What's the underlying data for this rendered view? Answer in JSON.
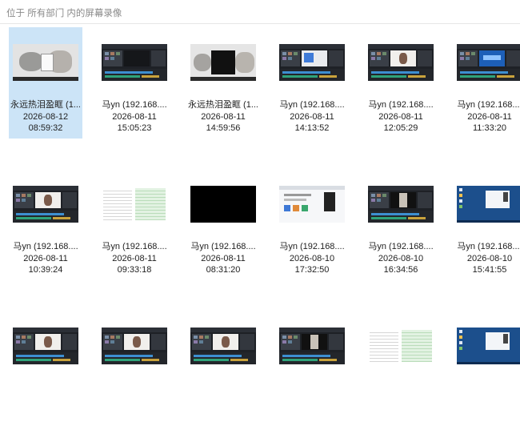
{
  "search": {
    "placeholder": "位于 所有部门 内的屏幕录像"
  },
  "items": [
    {
      "name": "永远热泪盈眶 (1...",
      "date": "2026-08-12",
      "time": "08:59:32",
      "thumb": "cat-image",
      "selected": true
    },
    {
      "name": "马yn (192.168....",
      "date": "2026-08-11",
      "time": "15:05:23",
      "thumb": "video-editor"
    },
    {
      "name": "永远热泪盈眶 (1...",
      "date": "2026-08-11",
      "time": "14:59:56",
      "thumb": "cat-image-dark"
    },
    {
      "name": "马yn (192.168....",
      "date": "2026-08-11",
      "time": "14:13:52",
      "thumb": "video-editor-dialog"
    },
    {
      "name": "马yn (192.168....",
      "date": "2026-08-11",
      "time": "12:05:29",
      "thumb": "video-editor-portrait"
    },
    {
      "name": "马yn (192.168....",
      "date": "2026-08-11",
      "time": "11:33:20",
      "thumb": "video-editor-blue"
    },
    {
      "name": "马yn (192.168....",
      "date": "2026-08-11",
      "time": "10:39:24",
      "thumb": "video-editor-portrait"
    },
    {
      "name": "马yn (192.168....",
      "date": "2026-08-11",
      "time": "09:33:18",
      "thumb": "spreadsheet"
    },
    {
      "name": "马yn (192.168....",
      "date": "2026-08-11",
      "time": "08:31:20",
      "thumb": "black"
    },
    {
      "name": "马yn (192.168....",
      "date": "2026-08-10",
      "time": "17:32:50",
      "thumb": "web-page"
    },
    {
      "name": "马yn (192.168....",
      "date": "2026-08-10",
      "time": "16:34:56",
      "thumb": "video-editor-phone"
    },
    {
      "name": "马yn (192.168....",
      "date": "2026-08-10",
      "time": "15:41:55",
      "thumb": "desktop"
    },
    {
      "name": "",
      "date": "",
      "time": "",
      "thumb": "video-editor-portrait"
    },
    {
      "name": "",
      "date": "",
      "time": "",
      "thumb": "video-editor-portrait"
    },
    {
      "name": "",
      "date": "",
      "time": "",
      "thumb": "video-editor-portrait"
    },
    {
      "name": "",
      "date": "",
      "time": "",
      "thumb": "video-editor-phone"
    },
    {
      "name": "",
      "date": "",
      "time": "",
      "thumb": "spreadsheet"
    },
    {
      "name": "",
      "date": "",
      "time": "",
      "thumb": "desktop"
    }
  ]
}
